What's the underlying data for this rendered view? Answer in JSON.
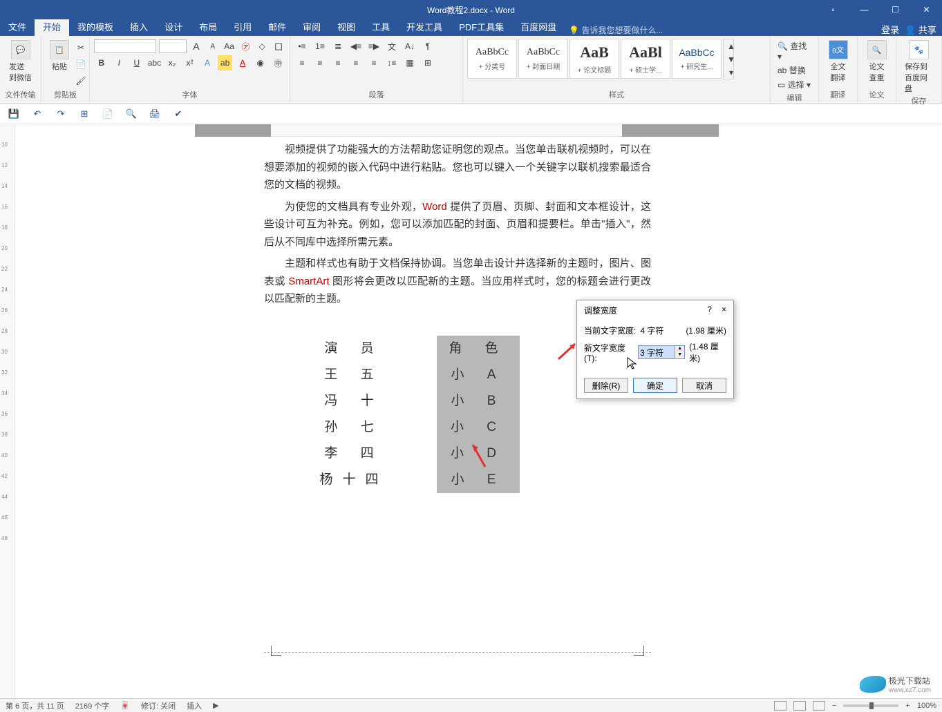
{
  "titlebar": {
    "title": "Word教程2.docx - Word"
  },
  "tabs": {
    "items": [
      "文件",
      "开始",
      "我的模板",
      "插入",
      "设计",
      "布局",
      "引用",
      "邮件",
      "审阅",
      "视图",
      "工具",
      "开发工具",
      "PDF工具集",
      "百度网盘"
    ],
    "tell": "告诉我您想要做什么...",
    "login": "登录",
    "share": "共享"
  },
  "ribbon": {
    "clipboard": {
      "send": "发送\n到微信",
      "paste": "粘贴",
      "label": "文件传输",
      "label2": "剪贴板"
    },
    "font": {
      "label": "字体",
      "size_a": "A",
      "size_minus": "A"
    },
    "para": {
      "label": "段落"
    },
    "styles": {
      "label": "样式",
      "items": [
        {
          "preview": "AaBbCc",
          "name": "+ 分类号",
          "cls": "preview-normal"
        },
        {
          "preview": "AaBbCc",
          "name": "+ 封面日期",
          "cls": "preview-normal"
        },
        {
          "preview": "AaB",
          "name": "+ 论文标题",
          "cls": "preview-large"
        },
        {
          "preview": "AaBl",
          "name": "+ 硕士学...",
          "cls": "preview-large"
        },
        {
          "preview": "AaBbCc",
          "name": "+ 研究生...",
          "cls": "preview-blue"
        }
      ]
    },
    "edit": {
      "find": "查找",
      "replace": "替换",
      "select": "选择",
      "label": "编辑"
    },
    "trans": {
      "full": "全文\n翻译",
      "thesis": "论文\n查重",
      "save": "保存到\n百度网盘",
      "label1": "翻译",
      "label2": "论文",
      "label3": "保存"
    }
  },
  "document": {
    "p1": "视频提供了功能强大的方法帮助您证明您的观点。当您单击联机视频时，可以在想要添加的视频的嵌入代码中进行粘贴。您也可以键入一个关键字以联机搜索最适合您的文档的视频。",
    "p2a": "为使您的文档具有专业外观，",
    "p2word": "Word",
    "p2b": " 提供了页眉、页脚、封面和文本框设计，这些设计可互为补充。例如，您可以添加匹配的封面、页眉和提要栏。单击\"插入\"，然后从不同库中选择所需元素。",
    "p3a": "主题和样式也有助于文档保持协调。当您单击设计并选择新的主题时，图片、图表或 ",
    "p3smart": "SmartArt",
    "p3b": " 图形将会更改以匹配新的主题。当应用样式时，您的标题会进行更改以匹配新的主题。",
    "col1": [
      "演  员",
      "王  五",
      "冯  十",
      "孙  七",
      "李  四",
      "杨十四"
    ],
    "col2": [
      "角  色",
      "小  A",
      "小  B",
      "小  C",
      "小  D",
      "小  E"
    ]
  },
  "dialog": {
    "title": "调整宽度",
    "help": "?",
    "close": "×",
    "cur_label": "当前文字宽度:",
    "cur_val": "4 字符",
    "cur_cm": "(1.98 厘米)",
    "new_label": "新文字宽度(T):",
    "new_val": "3 字符",
    "new_cm": "(1.48 厘米)",
    "delete": "删除(R)",
    "ok": "确定",
    "cancel": "取消"
  },
  "status": {
    "page": "第 6 页，共 11 页",
    "words": "2169 个字",
    "track": "修订: 关闭",
    "insert": "插入",
    "zoom": "100%"
  },
  "watermark": {
    "name": "极光下载站",
    "url": "www.xz7.com"
  }
}
